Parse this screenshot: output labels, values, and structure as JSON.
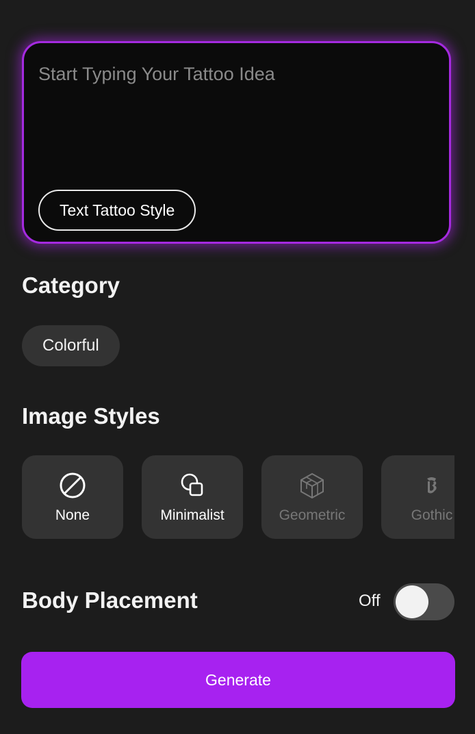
{
  "prompt": {
    "placeholder": "Start Typing Your Tattoo Idea",
    "style_chip_label": "Text Tattoo Style"
  },
  "category": {
    "title": "Category",
    "selected": "Colorful"
  },
  "image_styles": {
    "title": "Image Styles",
    "items": [
      {
        "label": "None",
        "icon": "no-symbol-icon",
        "enabled": true
      },
      {
        "label": "Minimalist",
        "icon": "overlapping-shapes-icon",
        "enabled": true
      },
      {
        "label": "Geometric",
        "icon": "geometric-cube-icon",
        "enabled": false
      },
      {
        "label": "Gothic",
        "icon": "gothic-letter-icon",
        "enabled": false
      }
    ]
  },
  "body_placement": {
    "title": "Body Placement",
    "toggle_label": "Off",
    "enabled": false
  },
  "generate": {
    "label": "Generate"
  },
  "colors": {
    "background": "#1c1c1c",
    "accent": "#a722f0",
    "card": "#333333"
  }
}
